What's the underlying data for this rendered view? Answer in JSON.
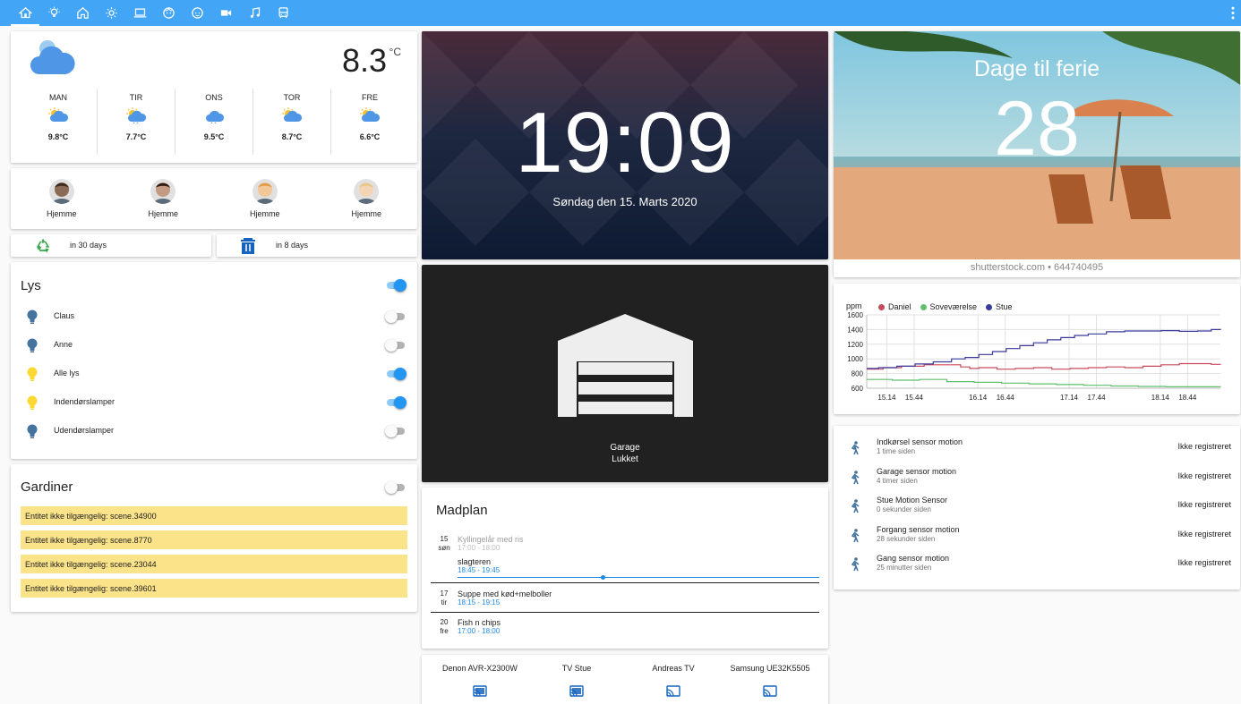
{
  "colors": {
    "topbar": "#42a5f5",
    "accent": "#2196f3",
    "bulb_on": "#fdd835",
    "bulb_off": "#44739e",
    "scene_bg": "#fbe38a"
  },
  "nav": {
    "tabs": [
      "home-icon",
      "lightbulb-icon",
      "home-outline-icon",
      "brightness-icon",
      "laptop-icon",
      "face-icon",
      "face-2-icon",
      "video-icon",
      "music-icon",
      "bus-icon"
    ],
    "menu_icon": "dots-vertical-icon"
  },
  "weather": {
    "temperature": "8.3",
    "unit": "°C",
    "icon": "partly-cloudy-icon",
    "forecast": [
      {
        "day": "MAN",
        "temp": "9.8°C",
        "icon": "partly-cloudy-sun-icon"
      },
      {
        "day": "TIR",
        "temp": "7.7°C",
        "icon": "cloud-sun-rain-icon"
      },
      {
        "day": "ONS",
        "temp": "9.5°C",
        "icon": "cloud-rain-icon"
      },
      {
        "day": "TOR",
        "temp": "8.7°C",
        "icon": "partly-cloudy-sun-icon"
      },
      {
        "day": "FRE",
        "temp": "6.6°C",
        "icon": "partly-cloudy-sun-icon"
      }
    ]
  },
  "persons": [
    {
      "state": "Hjemme"
    },
    {
      "state": "Hjemme"
    },
    {
      "state": "Hjemme"
    },
    {
      "state": "Hjemme"
    }
  ],
  "reminders": [
    {
      "text": "in 30 days",
      "icon": "recycle-icon"
    },
    {
      "text": "in 8 days",
      "icon": "trash-can-icon"
    }
  ],
  "lys": {
    "title": "Lys",
    "master_on": true,
    "items": [
      {
        "label": "Claus",
        "on": false
      },
      {
        "label": "Anne",
        "on": false
      },
      {
        "label": "Alle lys",
        "on": true
      },
      {
        "label": "Indendørslamper",
        "on": true
      },
      {
        "label": "Udendørslamper",
        "on": false
      }
    ]
  },
  "gardiner": {
    "title": "Gardiner",
    "master_on": false,
    "warnings": [
      "Entitet ikke tilgængelig: scene.34900",
      "Entitet ikke tilgængelig: scene.8770",
      "Entitet ikke tilgængelig: scene.23044",
      "Entitet ikke tilgængelig: scene.39601"
    ]
  },
  "clock": {
    "time": "19:09",
    "date": "Søndag den 15. Marts 2020"
  },
  "garage": {
    "name": "Garage",
    "state": "Lukket"
  },
  "ferie": {
    "title": "Dage til ferie",
    "count": "28",
    "watermark": "shutterstock.com • 644740495"
  },
  "madplan": {
    "title": "Madplan",
    "days": [
      {
        "date": "15",
        "weekday": "søn",
        "events": [
          {
            "title": "Kyllingelår med ris",
            "time": "17:00 - 18:00",
            "past": true
          },
          {
            "title": "slagteren",
            "time": "18:45 - 19:45",
            "past": false
          }
        ]
      },
      {
        "date": "17",
        "weekday": "tir",
        "events": [
          {
            "title": "Suppe med kød+melboller",
            "time": "18:15 - 19:15",
            "past": false
          }
        ]
      },
      {
        "date": "20",
        "weekday": "fre",
        "events": [
          {
            "title": "Fish n chips",
            "time": "17:00 - 18:00",
            "past": false
          }
        ]
      }
    ]
  },
  "media": [
    {
      "name": "Denon AVR-X2300W",
      "icon": "cast-connected-icon"
    },
    {
      "name": "TV Stue",
      "icon": "cast-connected-icon"
    },
    {
      "name": "Andreas TV",
      "icon": "cast-icon"
    },
    {
      "name": "Samsung UE32K5505",
      "icon": "cast-icon"
    }
  ],
  "chart_data": {
    "type": "line",
    "ylabel": "ppm",
    "ylim": [
      600,
      1600
    ],
    "yticks": [
      "1600",
      "1400",
      "1200",
      "1000",
      "800",
      "600"
    ],
    "xticks": [
      "15.14",
      "15.44",
      "16.14",
      "16.44",
      "17.14",
      "17.44",
      "18.14",
      "18.44"
    ],
    "x_range": [
      14.92,
      18.8
    ],
    "grid": true,
    "legend_position": "top",
    "series": [
      {
        "name": "Daniel",
        "color": "#c64b5c",
        "step": true,
        "points": [
          [
            14.92,
            860
          ],
          [
            15.1,
            880
          ],
          [
            15.3,
            900
          ],
          [
            15.55,
            920
          ],
          [
            15.8,
            920
          ],
          [
            15.95,
            890
          ],
          [
            16.05,
            870
          ],
          [
            16.15,
            880
          ],
          [
            16.35,
            860
          ],
          [
            16.55,
            870
          ],
          [
            16.75,
            880
          ],
          [
            16.95,
            860
          ],
          [
            17.15,
            870
          ],
          [
            17.35,
            880
          ],
          [
            17.55,
            890
          ],
          [
            17.75,
            880
          ],
          [
            17.95,
            900
          ],
          [
            18.15,
            920
          ],
          [
            18.35,
            935
          ],
          [
            18.55,
            935
          ],
          [
            18.7,
            925
          ],
          [
            18.8,
            920
          ]
        ]
      },
      {
        "name": "Soveværelse",
        "color": "#5fbf6a",
        "step": true,
        "points": [
          [
            14.92,
            720
          ],
          [
            15.2,
            710
          ],
          [
            15.5,
            720
          ],
          [
            15.8,
            690
          ],
          [
            16.1,
            680
          ],
          [
            16.4,
            670
          ],
          [
            16.7,
            660
          ],
          [
            17.0,
            650
          ],
          [
            17.3,
            640
          ],
          [
            17.6,
            630
          ],
          [
            17.9,
            625
          ],
          [
            18.2,
            620
          ],
          [
            18.5,
            620
          ],
          [
            18.8,
            615
          ]
        ]
      },
      {
        "name": "Stue",
        "color": "#3a3b9a",
        "step": true,
        "points": [
          [
            14.92,
            870
          ],
          [
            15.05,
            880
          ],
          [
            15.25,
            900
          ],
          [
            15.45,
            930
          ],
          [
            15.65,
            960
          ],
          [
            15.85,
            1000
          ],
          [
            16.0,
            1020
          ],
          [
            16.15,
            1060
          ],
          [
            16.3,
            1100
          ],
          [
            16.45,
            1140
          ],
          [
            16.6,
            1180
          ],
          [
            16.75,
            1220
          ],
          [
            16.9,
            1260
          ],
          [
            17.05,
            1290
          ],
          [
            17.2,
            1320
          ],
          [
            17.35,
            1340
          ],
          [
            17.55,
            1370
          ],
          [
            17.75,
            1380
          ],
          [
            17.95,
            1380
          ],
          [
            18.15,
            1385
          ],
          [
            18.35,
            1375
          ],
          [
            18.55,
            1380
          ],
          [
            18.7,
            1400
          ],
          [
            18.8,
            1410
          ]
        ]
      }
    ]
  },
  "motion": [
    {
      "name": "Indkørsel sensor motion",
      "since": "1 time siden",
      "state": "Ikke registreret"
    },
    {
      "name": "Garage sensor motion",
      "since": "4 timer siden",
      "state": "Ikke registreret"
    },
    {
      "name": "Stue Motion Sensor",
      "since": "0 sekunder siden",
      "state": "Ikke registreret"
    },
    {
      "name": "Forgang sensor motion",
      "since": "28 sekunder siden",
      "state": "Ikke registreret"
    },
    {
      "name": "Gang sensor motion",
      "since": "25 minutter siden",
      "state": "Ikke registreret"
    }
  ]
}
